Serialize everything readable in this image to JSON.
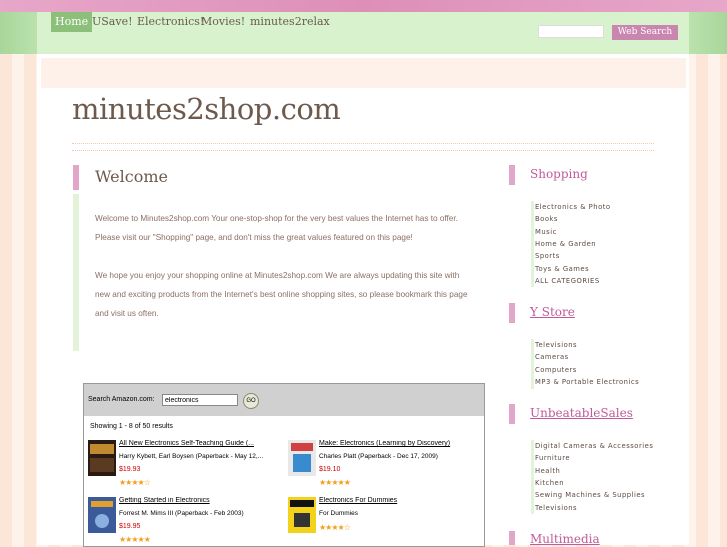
{
  "nav": {
    "items": [
      "Home",
      "USave!",
      "Electronics!",
      "Movies!",
      "minutes2relax"
    ],
    "active_index": 0
  },
  "search": {
    "button_label": "Web Search",
    "value": ""
  },
  "site": {
    "title": "minutes2shop.com"
  },
  "welcome": {
    "title": "Welcome",
    "paragraphs": [
      "Welcome to Minutes2shop.com Your one-stop-shop for the very best values the Internet has to offer. Please visit our \"Shopping\" page, and don't miss the great values featured on this page!",
      "We hope you enjoy your shopping online at Minutes2shop.com We are always updating this site with new and exciting products from the Internet's best online shopping sites, so please bookmark this page and visit us often."
    ]
  },
  "amazon": {
    "search_label": "Search Amazon.com:",
    "search_value": "electronics",
    "go_label": "GO",
    "count_text": "Showing 1 - 8 of 50 results",
    "products": [
      {
        "title": "All New Electronics Self-Teaching Guide (...",
        "author": "Harry Kybett, Earl Boysen (Paperback - May 12,...",
        "price": "$19.93",
        "stars": "★★★★☆"
      },
      {
        "title": "Make: Electronics (Learning by Discovery)",
        "author": "Charles Platt (Paperback - Dec 17, 2009)",
        "price": "$19.10",
        "stars": "★★★★★"
      },
      {
        "title": "Getting Started in Electronics",
        "author": "Forrest M. Mims III (Paperback - Feb 2003)",
        "price": "$19.95",
        "stars": "★★★★★"
      },
      {
        "title": "Electronics For Dummies",
        "author": "For Dummies",
        "price": "",
        "stars": "★★★★☆"
      }
    ]
  },
  "sidebar": {
    "sections": [
      {
        "title": "Shopping",
        "is_link": false,
        "items": [
          "Electronics & Photo",
          "Books",
          "Music",
          "Home & Garden",
          "Sports",
          "Toys & Games",
          "ALL CATEGORIES"
        ]
      },
      {
        "title": "Y Store",
        "is_link": true,
        "items": [
          "Televisions",
          "Cameras",
          "Computers",
          "MP3 & Portable Electronics"
        ]
      },
      {
        "title": "UnbeatableSales",
        "is_link": true,
        "items": [
          "Digital Cameras & Accessories",
          "Furniture",
          "Health",
          "Kitchen",
          "Sewing Machines & Supplies",
          "Televisions"
        ]
      },
      {
        "title": "Multimedia",
        "is_link": true,
        "items": []
      }
    ]
  },
  "colors": {
    "accent_pink": "#e2a6cb",
    "nav_green": "#d8f2cd",
    "nav_active": "#8bbf7a",
    "title_brown": "#6d5a4d",
    "sidebar_link_pink": "#c05a9a",
    "price_red": "#cc0000"
  }
}
